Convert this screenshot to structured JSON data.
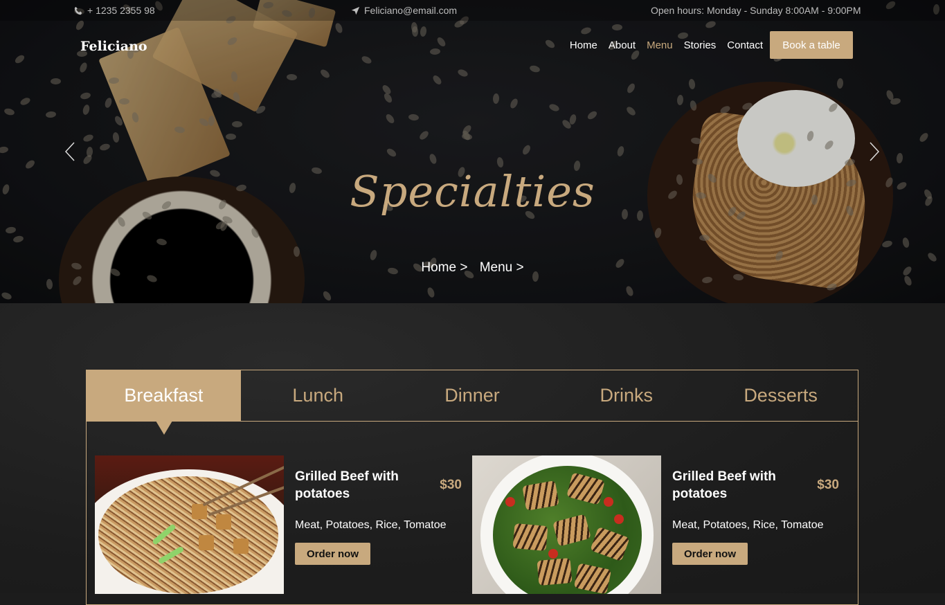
{
  "topbar": {
    "phone": "+ 1235 2355 98",
    "email": "Feliciano@email.com",
    "hours": "Open hours: Monday - Sunday 8:00AM - 9:00PM"
  },
  "brand": "Feliciano",
  "nav": {
    "items": [
      "Home",
      "About",
      "Menu",
      "Stories",
      "Contact"
    ],
    "active": "Menu",
    "cta": "Book a table"
  },
  "hero": {
    "title": "Specialties",
    "breadcrumb": [
      "Home >",
      "Menu >"
    ]
  },
  "tabs": [
    "Breakfast",
    "Lunch",
    "Dinner",
    "Drinks",
    "Desserts"
  ],
  "active_tab": "Breakfast",
  "dishes": [
    {
      "name": "Grilled Beef with potatoes",
      "price": "$30",
      "description": "Meat, Potatoes, Rice, Tomatoe",
      "button": "Order now"
    },
    {
      "name": "Grilled Beef with potatoes",
      "price": "$30",
      "description": "Meat, Potatoes, Rice, Tomatoe",
      "button": "Order now"
    }
  ],
  "colors": {
    "accent": "#c8a97e",
    "background": "#1c1c1c"
  }
}
